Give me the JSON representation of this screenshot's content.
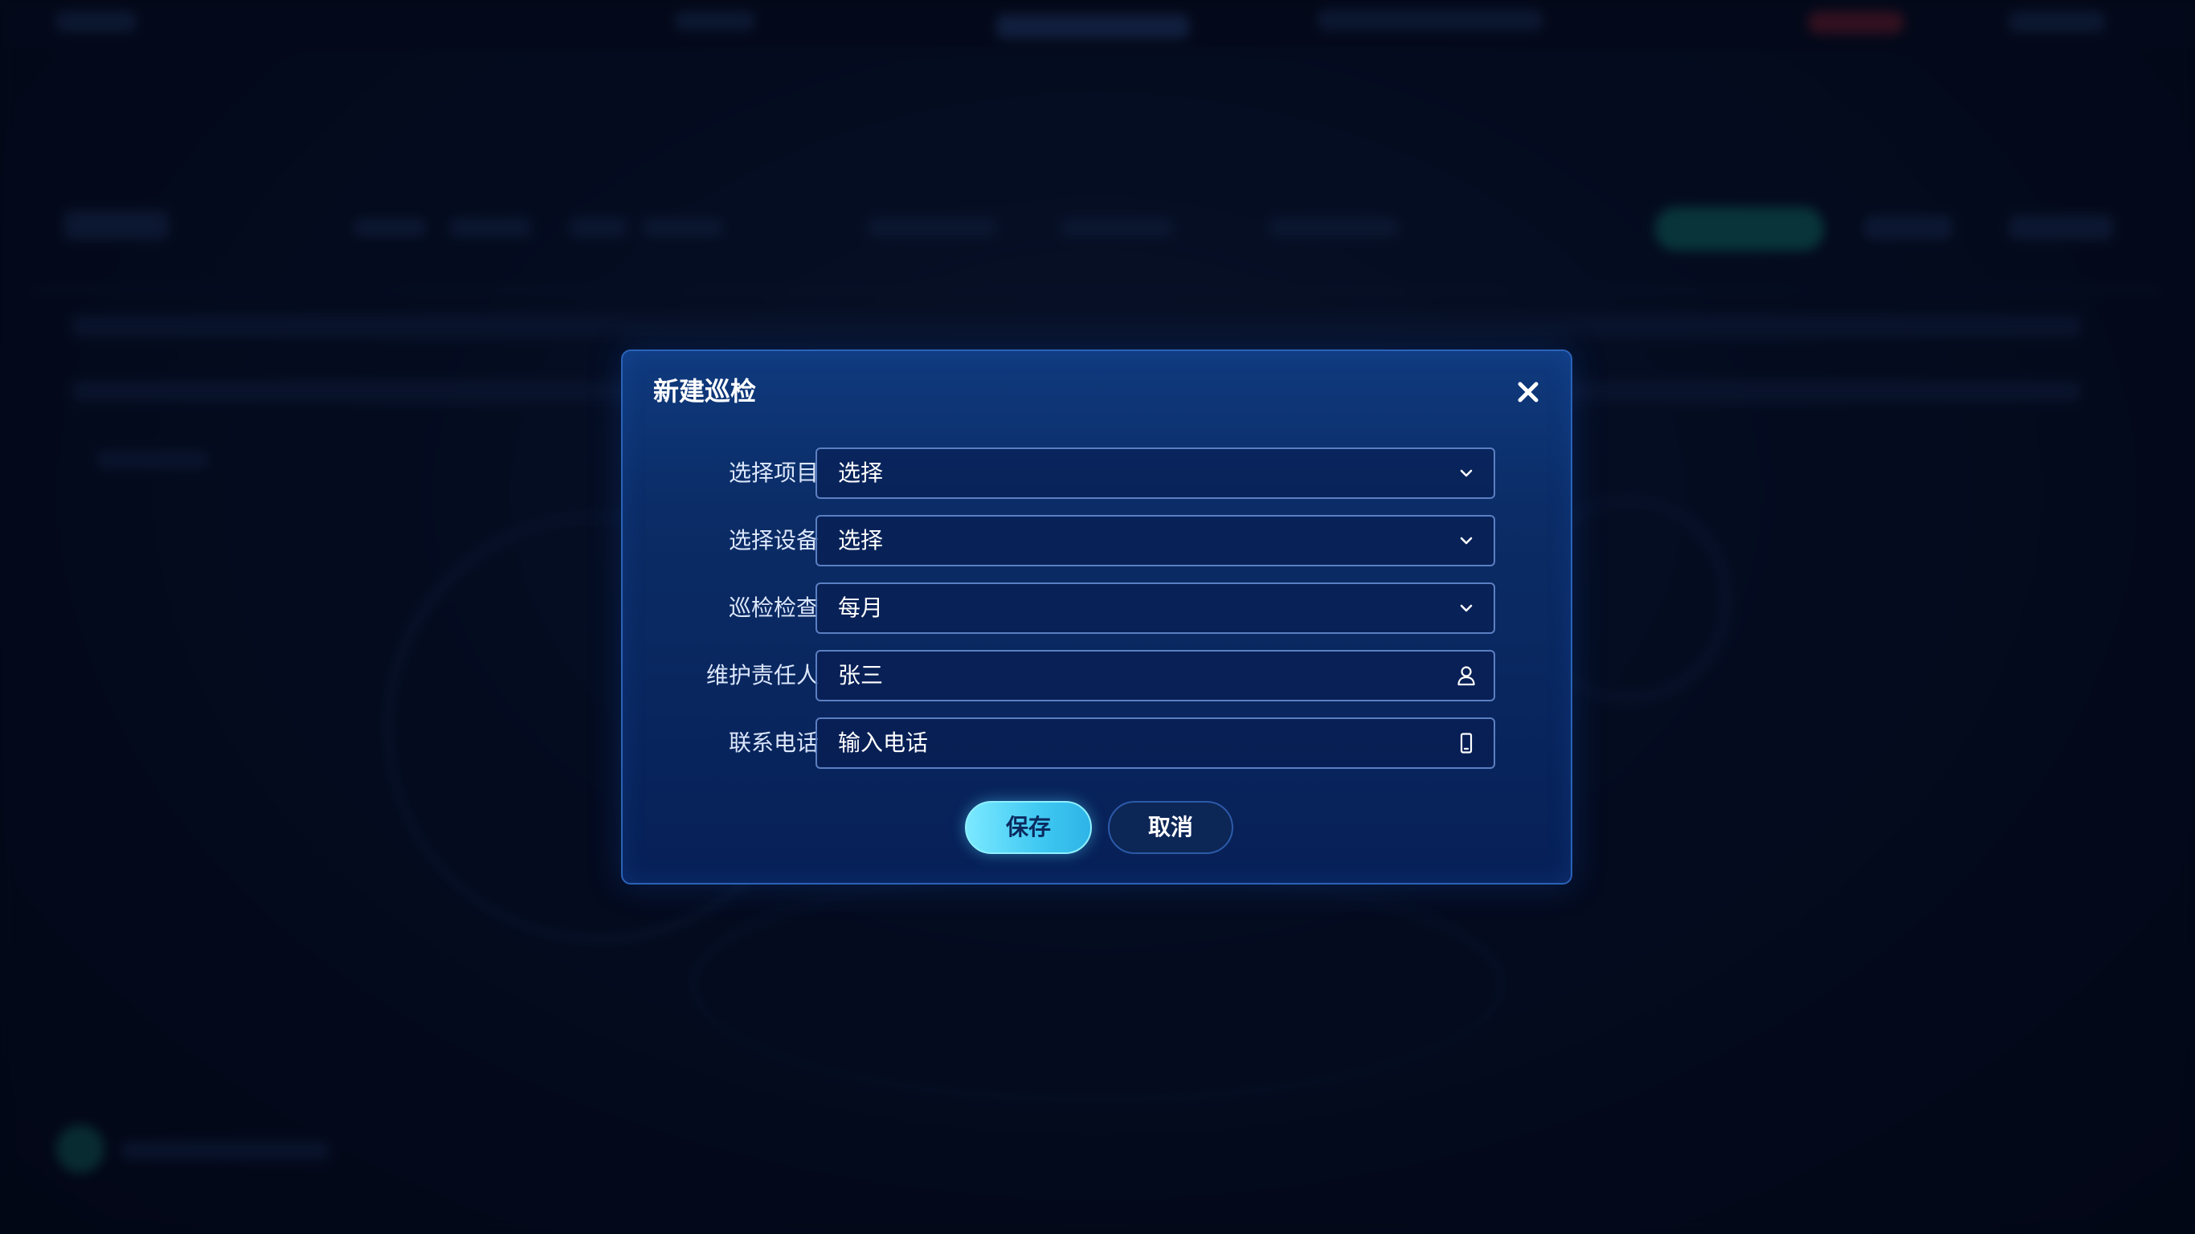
{
  "dialog": {
    "title": "新建巡检"
  },
  "form": {
    "project": {
      "label": "选择项目",
      "value": "选择",
      "icon": "chevron-down-icon"
    },
    "device": {
      "label": "选择设备",
      "value": "选择",
      "icon": "chevron-down-icon"
    },
    "inspection": {
      "label": "巡检检查",
      "value": "每月",
      "icon": "chevron-down-icon"
    },
    "maintainer": {
      "label": "维护责任人",
      "value": "张三",
      "icon": "user-icon"
    },
    "phone": {
      "label": "联系电话",
      "placeholder": "输入电话",
      "icon": "phone-icon"
    }
  },
  "actions": {
    "save_label": "保存",
    "cancel_label": "取消"
  },
  "theme": {
    "modal_bg": "#0b2c66",
    "modal_border": "#2a63b8",
    "field_border": "#5b7fc2",
    "accent": "#3fc8f2"
  }
}
